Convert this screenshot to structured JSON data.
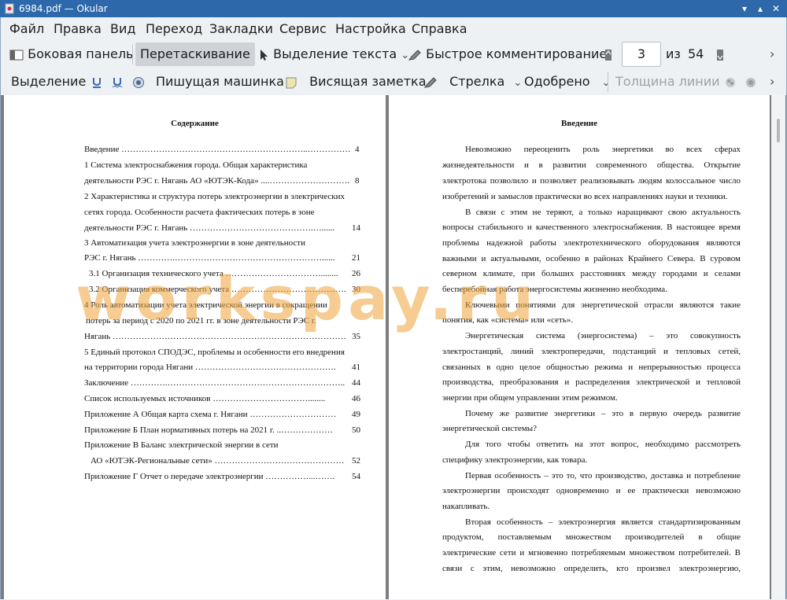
{
  "window": {
    "title": "6984.pdf  — Okular"
  },
  "menu": [
    "Файл",
    "Правка",
    "Вид",
    "Переход",
    "Закладки",
    "Сервис",
    "Настройка",
    "Справка"
  ],
  "toolbar1": {
    "sidebar": "Боковая панель",
    "drag": "Перетаскивание",
    "text_select": "Выделение текста",
    "quick_comment": "Быстрое комментирование",
    "page_current": "3",
    "page_of": "из",
    "page_total": "54"
  },
  "toolbar2": {
    "selection": "Выделение",
    "typewriter": "Пишущая машинка",
    "sticky_note": "Висящая заметка",
    "arrow": "Стрелка",
    "approved": "Одобрено",
    "line_width": "Толщина линии"
  },
  "page1": {
    "heading": "Содержание",
    "toc": [
      {
        "text": "Введение ………………………………………………………..……………",
        "page": "4"
      },
      {
        "text": "1 Система электроснабжения города. Общая характеристика",
        "page": ""
      },
      {
        "text": "деятельности РЭС г. Нягань АО «ЮТЭК-Кода» ....……………………….",
        "page": "8"
      },
      {
        "text": "2 Характеристика и структура потерь электроэнергии в электрических",
        "page": ""
      },
      {
        "text": "сетях города. Особенности расчета фактических потерь в зоне",
        "page": ""
      },
      {
        "text": "деятельности РЭС г. Нягань …………………………………….…......",
        "page": "14"
      },
      {
        "text": "3 Автоматизация учета электроэнергии в зоне деятельности",
        "page": ""
      },
      {
        "text": "РЭС г. Нягань ………….……………………………………………......",
        "page": "21"
      },
      {
        "text": "3.1 Организация технического учета ……………………………........",
        "page": "26"
      },
      {
        "text": "3.2 Организация коммерческого учета ………………………………….",
        "page": "30"
      },
      {
        "text": "4 Роль автоматизации учета электрической энергии в сокращении",
        "page": ""
      },
      {
        "text": "потерь за период с 2020 по 2021 гг.  в зоне деятельности РЭС г.",
        "page": ""
      },
      {
        "text": "Нягань ………………………………………………………………………",
        "page": "35"
      },
      {
        "text": "5 Единый протокол СПОДЭС, проблемы и особенности его внедрения",
        "page": ""
      },
      {
        "text": "на территории города Нягани ………………………………………….",
        "page": "41"
      },
      {
        "text": "Заключение ………….……………………………………………………..",
        "page": "44"
      },
      {
        "text": "Список используемых источников ……………………………........",
        "page": "46"
      },
      {
        "text": "Приложение А Общая карта схема г. Нягани …………………………",
        "page": "49"
      },
      {
        "text": "Приложение Б План нормативных потерь на 2021 г. ..………………",
        "page": "50"
      },
      {
        "text": "Приложение В Баланс электрической энергии в сети",
        "page": ""
      },
      {
        "text": "АО «ЮТЭК-Региональные сети» ………………………………………",
        "page": "52"
      },
      {
        "text": "Приложение Г Отчет о передаче электроэнергии ……………...…….",
        "page": "54"
      }
    ]
  },
  "page2": {
    "heading": "Введение",
    "lines": [
      "Невозможно переоценить роль энергетики во всех сферах",
      "жизнедеятельности и в развитии современного общества. Открытие",
      "электротока позволило и позволяет реализовывать людям колоссальное число",
      "изобретений и замыслов практически во всех направлениях науки и техники.",
      "В связи с этим не теряют, а только наращивают свою актуальность",
      "вопросы стабильного и качественного электроснабжения. В настоящее время",
      "проблемы надежной работы электротехнического оборудования являются",
      "важными и актуальными, особенно в районах Крайнего Севера. В суровом",
      "северном климате, при больших расстояниях между городами и селами",
      "бесперебойная работа энергосистемы жизненно необходима.",
      "Ключевыми понятиями для энергетической отрасли являются такие",
      "понятия, как «система» или «сеть».",
      "Энергетическая система (энергосистема) – это совокупность",
      "электростанций, линий электропередачи, подстанций и тепловых сетей,",
      "связанных в одно целое общностью режима и непрерывностью процесса",
      "производства, преобразования и распределения электрической и тепловой",
      "энергии при общем управлении этим режимом.",
      "Почему же развитие энергетики – это в первую очередь развитие",
      "энергетической системы?",
      "Для того чтобы ответить на этот вопрос, необходимо рассмотреть",
      "специфику электроэнергии, как товара.",
      "Первая особенность – это то, что производство, доставка и потребление",
      "электроэнергии происходят одновременно и ее практически невозможно",
      "накапливать.",
      "Вторая особенность – электроэнергия является стандартизированным",
      "продуктом, поставляемым множеством производителей в общие",
      "электрические сети и мгновенно потребляемым множеством потребителей. В",
      "связи с этим, невозможно определить, кто произвел электроэнергию,"
    ]
  },
  "watermark": "workspay.ru",
  "colors": {
    "titlebar": "#2d68ab",
    "watermark": "#f0a43a"
  }
}
